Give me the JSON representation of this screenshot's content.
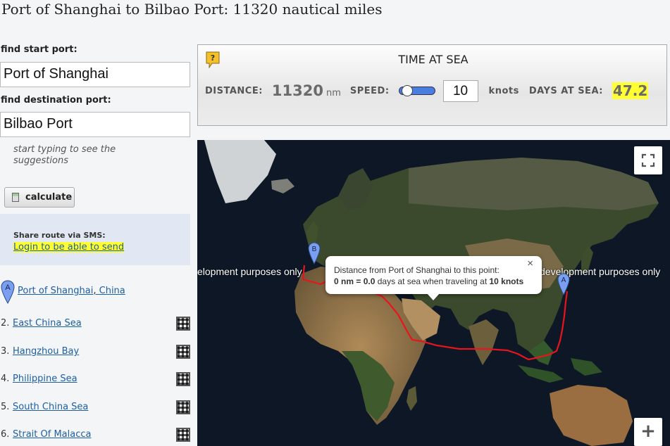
{
  "title": "Port of Shanghai to Bilbao Port: 11320 nautical miles",
  "form": {
    "start_label": "find start port:",
    "start_value": "Port of Shanghai",
    "dest_label": "find destination port:",
    "dest_value": "Bilbao Port",
    "hint": "start typing to see the suggestions",
    "calculate_label": "calculate"
  },
  "sms": {
    "title": "Share route via SMS:",
    "link": "Login to be able to send"
  },
  "route": {
    "start": {
      "marker": "A",
      "port": "Port of Shanghai",
      "separator": ",",
      "country": "China"
    },
    "items": [
      {
        "num": "2.",
        "name": "East China Sea"
      },
      {
        "num": "3.",
        "name": "Hangzhou Bay"
      },
      {
        "num": "4.",
        "name": "Philippine Sea"
      },
      {
        "num": "5.",
        "name": "South China Sea"
      },
      {
        "num": "6.",
        "name": "Strait Of Malacca"
      }
    ]
  },
  "time_at_sea": {
    "help": "?",
    "title": "TIME AT SEA",
    "distance_label": "DISTANCE:",
    "distance_value": "11320",
    "distance_unit": "nm",
    "speed_label": "SPEED:",
    "speed_value": "10",
    "speed_unit": "knots",
    "days_label": "DAYS AT SEA:",
    "days_value": "47.2",
    "slider_level": 0.05
  },
  "map": {
    "watermark_left": "elopment purposes only",
    "watermark_right": "development purposes only",
    "marker_a": "A",
    "marker_b": "B",
    "tooltip": {
      "close": "×",
      "line1": "Distance from Port of Shanghai to this point:",
      "nm_value": "0 nm",
      "eq": " = ",
      "days_value": "0.0",
      "middle": " days at sea when traveling at ",
      "speed": "10 knots"
    },
    "zoom_in": "+",
    "route_color": "#e8141e"
  }
}
